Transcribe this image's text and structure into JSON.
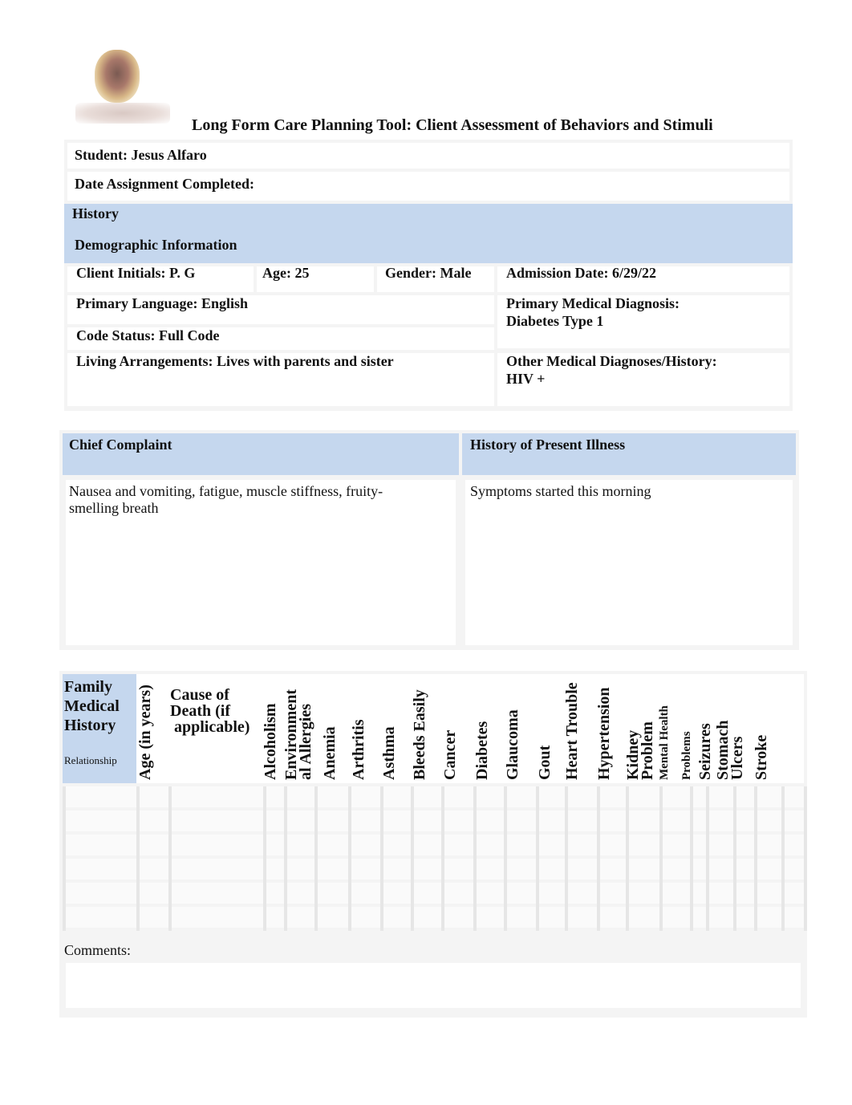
{
  "logo": {
    "icon": "school-crest-logo"
  },
  "title": "Long Form Care Planning Tool: Client Assessment of Behaviors and Stimuli",
  "header": {
    "student": "Student: Jesus Alfaro",
    "date_completed": "Date Assignment Completed:"
  },
  "history": {
    "section_label": "History",
    "demographic_label": "Demographic Information",
    "client_initials": "Client Initials: P. G",
    "age": "Age: 25",
    "gender": "Gender: Male",
    "admission_date": "Admission Date: 6/29/22",
    "primary_language": "Primary Language: English",
    "primary_diagnosis_label": "Primary Medical Diagnosis:",
    "primary_diagnosis_value": "Diabetes Type 1",
    "code_status": "Code Status: Full Code",
    "living_arrangements": "Living Arrangements: Lives with parents and sister",
    "other_diagnoses_label": "Other Medical Diagnoses/History:",
    "other_diagnoses_value": "HIV +"
  },
  "chief_complaint": {
    "label": "Chief Complaint",
    "value_line1": "Nausea and vomiting, fatigue, muscle stiffness, fruity-",
    "value_line2": "smelling breath"
  },
  "present_illness": {
    "label": "History of Present Illness",
    "value": "Symptoms started this morning"
  },
  "family_history": {
    "title_line1": "Family",
    "title_line2": "Medical",
    "title_line3": "History",
    "relationship_label": "Relationship",
    "age_label": "Age (in years)",
    "cause_line1": "Cause of",
    "cause_line2": "Death (if",
    "cause_line3": " applicable)",
    "conditions": [
      "Alcoholism",
      "Environment\nal Allergies",
      "Anemia",
      "Arthritis",
      "Asthma",
      "Bleeds Easily",
      "Cancer",
      "Diabetes",
      "Glaucoma",
      "Gout",
      "Heart Trouble",
      "Hypertension",
      "Kidney\nProblem",
      "Mental Health",
      "Problems",
      "Seizures",
      "Stomach\nUlcers",
      "Stroke"
    ],
    "rows": [
      [
        "",
        "",
        ""
      ],
      [
        "",
        "",
        ""
      ],
      [
        "",
        "",
        ""
      ],
      [
        "",
        "",
        ""
      ],
      [
        "",
        "",
        ""
      ],
      [
        "",
        "",
        ""
      ]
    ],
    "comments_label": "Comments:",
    "comments_value": ""
  },
  "colors": {
    "header_blue": "#c5d7ee"
  }
}
